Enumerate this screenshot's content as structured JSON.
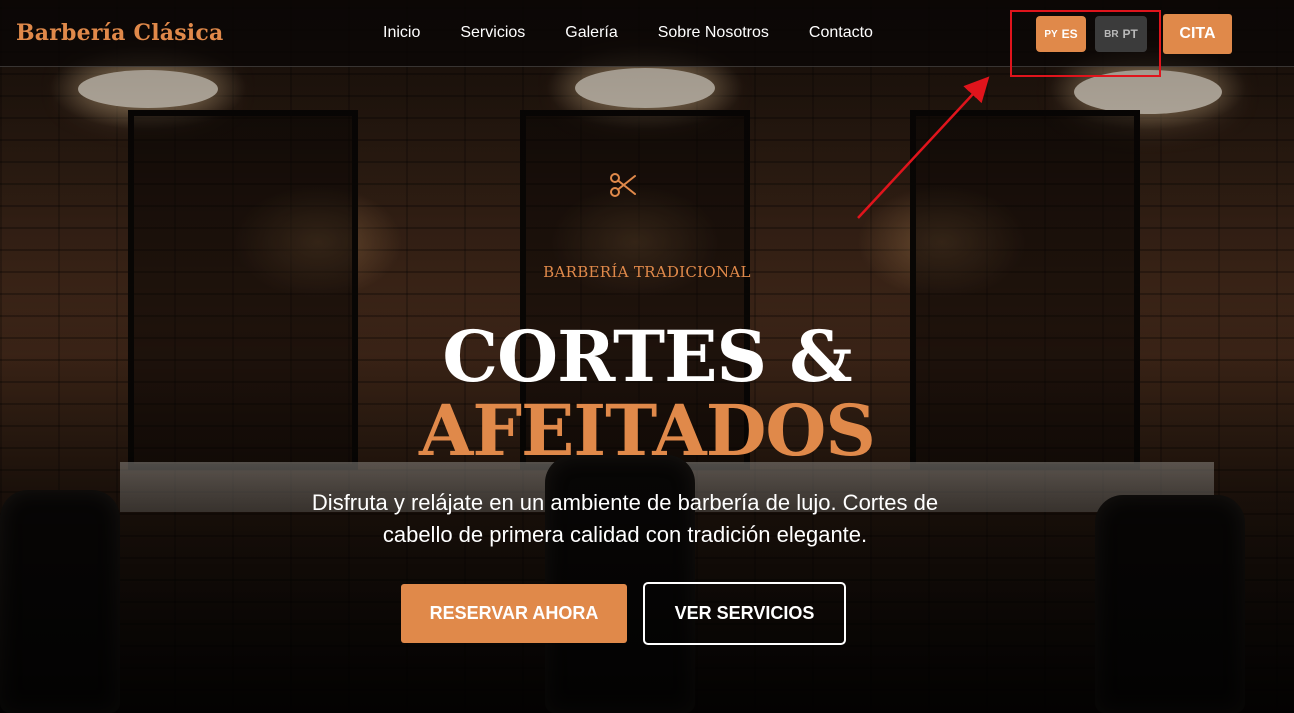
{
  "header": {
    "brand": "Barbería Clásica",
    "nav": [
      "Inicio",
      "Servicios",
      "Galería",
      "Sobre Nosotros",
      "Contacto"
    ],
    "languages": [
      {
        "country": "PY",
        "code": "ES",
        "active": true
      },
      {
        "country": "BR",
        "code": "PT",
        "active": false
      }
    ],
    "cta_label": "CITA"
  },
  "hero": {
    "icon": "scissors-icon",
    "eyebrow": "BARBERÍA TRADICIONAL",
    "title_line1": "CORTES &",
    "title_line2": "AFEITADOS",
    "description": "Disfruta y relájate en un ambiente de barbería de lujo. Cortes de cabello de primera calidad con tradición elegante.",
    "primary_button": "RESERVAR AHORA",
    "secondary_button": "VER SERVICIOS"
  },
  "colors": {
    "accent": "#e0894a",
    "header_bg": "#0a0705",
    "annotation": "#e0141c"
  }
}
